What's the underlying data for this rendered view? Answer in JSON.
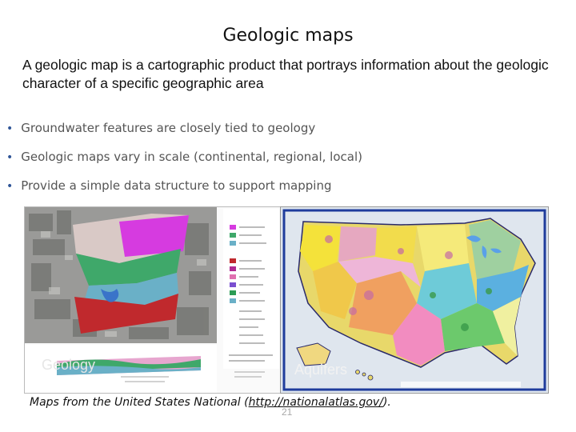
{
  "slide": {
    "title": "Geologic maps",
    "intro": "A geologic map is a cartographic product that portrays information about the geologic character of a specific geographic area",
    "bullets": [
      "Groundwater features are closely tied to geology",
      "Geologic maps vary in scale (continental, regional, local)",
      "Provide a simple data structure to support mapping"
    ],
    "bullet_glyph": "•",
    "images": {
      "geology_label": "Geology",
      "aquifers_label": "Aquifers"
    },
    "caption_prefix": "Maps from the United States National (",
    "caption_link": "http://nationalatlas.gov/",
    "caption_suffix": ").",
    "page_number": "21"
  },
  "colors": {
    "bullet": "#2f5597",
    "text": "#111111",
    "bullet_text": "#555555"
  }
}
